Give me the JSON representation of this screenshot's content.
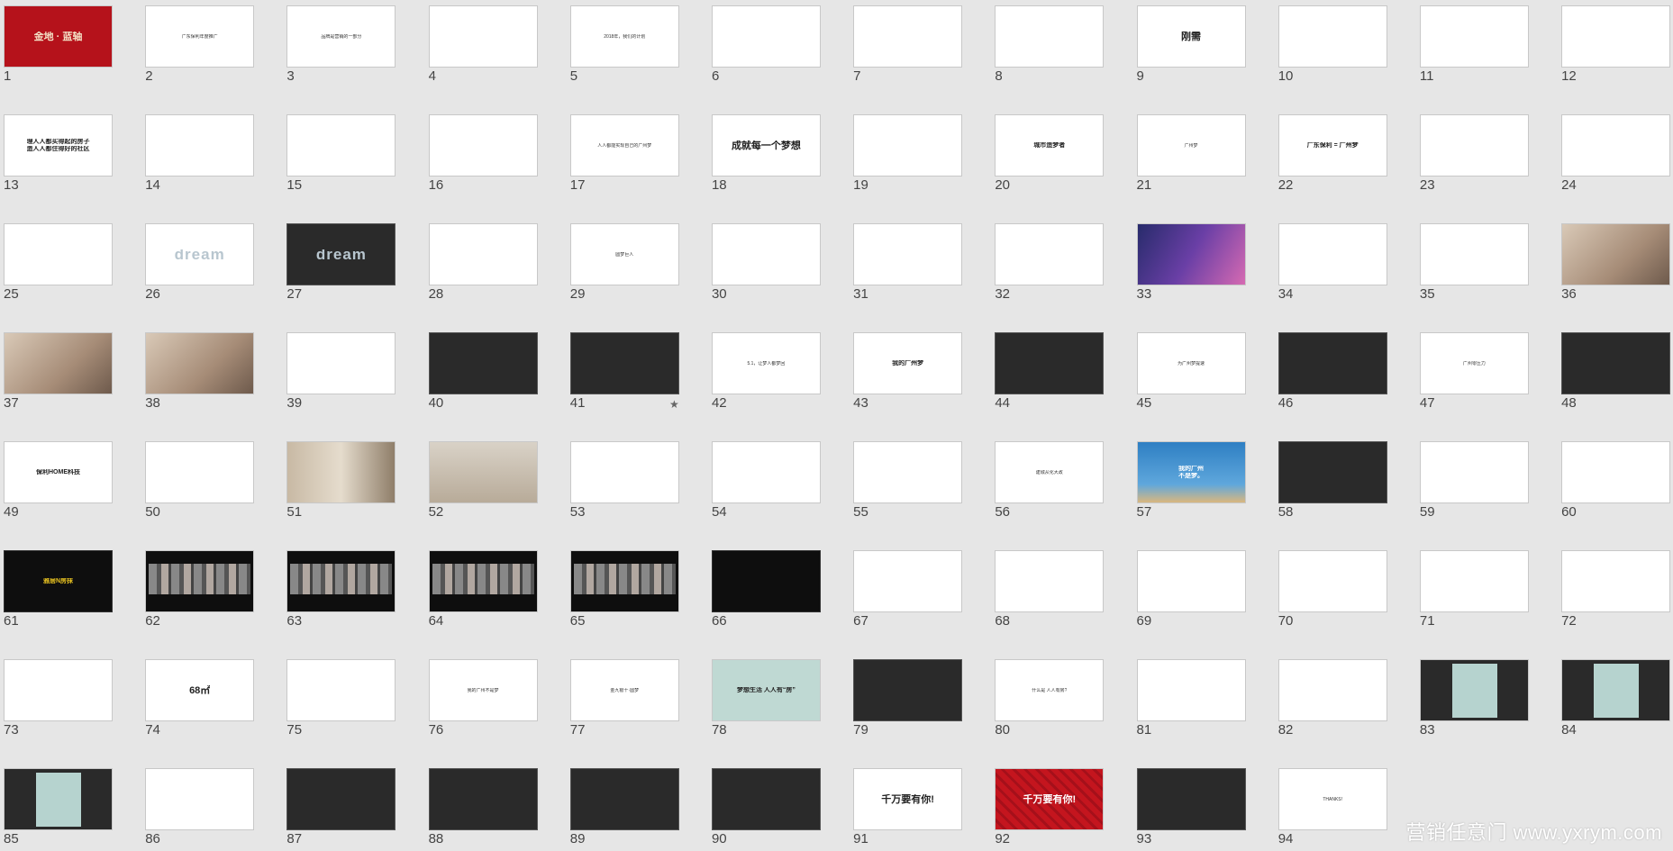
{
  "slides": [
    {
      "n": "1",
      "s": "red",
      "lines": [
        [
          "big",
          "金地 · 蓝轴"
        ],
        [
          "t",
          ""
        ]
      ]
    },
    {
      "n": "2",
      "s": "white",
      "lines": [
        [
          "t",
          "广东保利年度推广"
        ]
      ]
    },
    {
      "n": "3",
      "s": "white",
      "lines": [
        [
          "t",
          "品牌是营销的一部分"
        ]
      ]
    },
    {
      "n": "4",
      "s": "white",
      "lines": [
        [
          "t",
          ""
        ]
      ]
    },
    {
      "n": "5",
      "s": "white",
      "lines": [
        [
          "t",
          "2018年，我们的计划"
        ]
      ]
    },
    {
      "n": "6",
      "s": "white",
      "lines": [
        [
          "t",
          ""
        ]
      ]
    },
    {
      "n": "7",
      "s": "white",
      "lines": [
        [
          "t",
          ""
        ]
      ]
    },
    {
      "n": "8",
      "s": "white",
      "lines": [
        [
          "t",
          ""
        ]
      ]
    },
    {
      "n": "9",
      "s": "white",
      "lines": [
        [
          "big",
          "刚需"
        ]
      ]
    },
    {
      "n": "10",
      "s": "white",
      "lines": [
        [
          "t",
          ""
        ]
      ]
    },
    {
      "n": "11",
      "s": "white",
      "lines": [
        [
          "t",
          ""
        ]
      ]
    },
    {
      "n": "12",
      "s": "white",
      "lines": [
        [
          "t",
          ""
        ]
      ]
    },
    {
      "n": "13",
      "s": "white",
      "lines": [
        [
          "mid",
          "理人人都买得起的房子"
        ],
        [
          "mid",
          "造人人都住得好的社区"
        ]
      ]
    },
    {
      "n": "14",
      "s": "white",
      "lines": [
        [
          "t",
          ""
        ]
      ]
    },
    {
      "n": "15",
      "s": "white",
      "lines": [
        [
          "t",
          ""
        ]
      ]
    },
    {
      "n": "16",
      "s": "white",
      "lines": [
        [
          "t",
          ""
        ]
      ]
    },
    {
      "n": "17",
      "s": "white",
      "lines": [
        [
          "t",
          "人人都能实现自己的广州梦"
        ]
      ]
    },
    {
      "n": "18",
      "s": "white",
      "lines": [
        [
          "big",
          "成就每一个梦想"
        ]
      ]
    },
    {
      "n": "19",
      "s": "white",
      "lines": [
        [
          "t",
          ""
        ]
      ]
    },
    {
      "n": "20",
      "s": "white",
      "lines": [
        [
          "mid",
          "城市造梦者"
        ]
      ]
    },
    {
      "n": "21",
      "s": "white",
      "lines": [
        [
          "t",
          "广州梦"
        ]
      ]
    },
    {
      "n": "22",
      "s": "white",
      "lines": [
        [
          "mid",
          "广东保利 = 广州梦"
        ]
      ]
    },
    {
      "n": "23",
      "s": "white",
      "lines": [
        [
          "t",
          ""
        ]
      ]
    },
    {
      "n": "24",
      "s": "white",
      "lines": [
        [
          "t",
          ""
        ]
      ]
    },
    {
      "n": "25",
      "s": "white",
      "lines": [
        [
          "t",
          ""
        ]
      ]
    },
    {
      "n": "26",
      "s": "dream",
      "lines": [
        [
          "big",
          "dream"
        ]
      ]
    },
    {
      "n": "27",
      "s": "dreamdark",
      "lines": [
        [
          "big",
          "dream"
        ]
      ]
    },
    {
      "n": "28",
      "s": "white",
      "lines": [
        [
          "t",
          ""
        ]
      ]
    },
    {
      "n": "29",
      "s": "white",
      "lines": [
        [
          "t",
          "圆梦巨人"
        ]
      ]
    },
    {
      "n": "30",
      "s": "white",
      "lines": [
        [
          "t",
          ""
        ]
      ]
    },
    {
      "n": "31",
      "s": "white",
      "lines": [
        [
          "t",
          ""
        ]
      ]
    },
    {
      "n": "32",
      "s": "white",
      "lines": [
        [
          "t",
          ""
        ]
      ]
    },
    {
      "n": "33",
      "s": "scifi",
      "lines": [
        [
          "t",
          ""
        ]
      ]
    },
    {
      "n": "34",
      "s": "white",
      "lines": [
        [
          "t",
          ""
        ]
      ]
    },
    {
      "n": "35",
      "s": "white",
      "lines": [
        [
          "t",
          ""
        ]
      ]
    },
    {
      "n": "36",
      "s": "photo",
      "lines": [
        [
          "t",
          ""
        ]
      ]
    },
    {
      "n": "37",
      "s": "photo",
      "lines": [
        [
          "t",
          ""
        ]
      ]
    },
    {
      "n": "38",
      "s": "photo",
      "lines": [
        [
          "t",
          ""
        ]
      ]
    },
    {
      "n": "39",
      "s": "white",
      "lines": [
        [
          "t",
          ""
        ]
      ]
    },
    {
      "n": "40",
      "s": "dark",
      "lines": [
        [
          "t",
          ""
        ]
      ]
    },
    {
      "n": "41",
      "s": "dark",
      "lines": [
        [
          "t",
          ""
        ]
      ],
      "star": "★"
    },
    {
      "n": "42",
      "s": "white",
      "lines": [
        [
          "t",
          "5.1，让梦人都梦回"
        ]
      ]
    },
    {
      "n": "43",
      "s": "white",
      "lines": [
        [
          "mid",
          "我的广州梦"
        ]
      ]
    },
    {
      "n": "44",
      "s": "dark",
      "lines": [
        [
          "t",
          ""
        ]
      ]
    },
    {
      "n": "45",
      "s": "white",
      "lines": [
        [
          "t",
          "为广州梦提速"
        ]
      ]
    },
    {
      "n": "46",
      "s": "dark",
      "lines": [
        [
          "t",
          ""
        ]
      ]
    },
    {
      "n": "47",
      "s": "white",
      "lines": [
        [
          "t",
          "广州零压力"
        ]
      ]
    },
    {
      "n": "48",
      "s": "dark",
      "lines": [
        [
          "t",
          ""
        ]
      ]
    },
    {
      "n": "49",
      "s": "white",
      "lines": [
        [
          "mid",
          "保利HOME科技"
        ]
      ]
    },
    {
      "n": "50",
      "s": "white",
      "lines": [
        [
          "t",
          ""
        ]
      ]
    },
    {
      "n": "51",
      "s": "wall",
      "lines": [
        [
          "t",
          ""
        ]
      ]
    },
    {
      "n": "52",
      "s": "room",
      "lines": [
        [
          "t",
          ""
        ]
      ]
    },
    {
      "n": "53",
      "s": "white",
      "lines": [
        [
          "t",
          ""
        ]
      ]
    },
    {
      "n": "54",
      "s": "white",
      "lines": [
        [
          "t",
          ""
        ]
      ]
    },
    {
      "n": "55",
      "s": "white",
      "lines": [
        [
          "t",
          ""
        ]
      ]
    },
    {
      "n": "56",
      "s": "white",
      "lines": [
        [
          "t",
          "建城从化大政"
        ]
      ]
    },
    {
      "n": "57",
      "s": "blue",
      "lines": [
        [
          "mid",
          "我的广州"
        ],
        [
          "mid",
          "不是梦。"
        ]
      ]
    },
    {
      "n": "58",
      "s": "dark",
      "lines": [
        [
          "t",
          ""
        ]
      ]
    },
    {
      "n": "59",
      "s": "white",
      "lines": [
        [
          "t",
          ""
        ]
      ]
    },
    {
      "n": "60",
      "s": "white",
      "lines": [
        [
          "t",
          ""
        ]
      ]
    },
    {
      "n": "61",
      "s": "black",
      "lines": [
        [
          "mid",
          "雅居N房抹"
        ]
      ]
    },
    {
      "n": "62",
      "s": "street",
      "lines": [
        [
          "t",
          ""
        ]
      ]
    },
    {
      "n": "63",
      "s": "street",
      "lines": [
        [
          "t",
          ""
        ]
      ]
    },
    {
      "n": "64",
      "s": "street",
      "lines": [
        [
          "t",
          ""
        ]
      ]
    },
    {
      "n": "65",
      "s": "street",
      "lines": [
        [
          "t",
          ""
        ]
      ]
    },
    {
      "n": "66",
      "s": "black",
      "lines": [
        [
          "t",
          ""
        ]
      ]
    },
    {
      "n": "67",
      "s": "white",
      "lines": [
        [
          "t",
          ""
        ]
      ]
    },
    {
      "n": "68",
      "s": "white",
      "lines": [
        [
          "t",
          ""
        ]
      ]
    },
    {
      "n": "69",
      "s": "white",
      "lines": [
        [
          "t",
          ""
        ]
      ]
    },
    {
      "n": "70",
      "s": "white",
      "lines": [
        [
          "t",
          ""
        ]
      ]
    },
    {
      "n": "71",
      "s": "white",
      "lines": [
        [
          "t",
          ""
        ]
      ]
    },
    {
      "n": "72",
      "s": "white",
      "lines": [
        [
          "t",
          ""
        ]
      ]
    },
    {
      "n": "73",
      "s": "white",
      "lines": [
        [
          "t",
          ""
        ]
      ]
    },
    {
      "n": "74",
      "s": "white",
      "lines": [
        [
          "big",
          "68㎡"
        ]
      ]
    },
    {
      "n": "75",
      "s": "white",
      "lines": [
        [
          "t",
          ""
        ]
      ]
    },
    {
      "n": "76",
      "s": "white",
      "lines": [
        [
          "t",
          "我的广州不是梦"
        ]
      ]
    },
    {
      "n": "77",
      "s": "white",
      "lines": [
        [
          "t",
          "金九银十·圆梦"
        ]
      ]
    },
    {
      "n": "78",
      "s": "mint",
      "lines": [
        [
          "mid",
          "梦想生活 人人有“房”"
        ]
      ]
    },
    {
      "n": "79",
      "s": "dark",
      "lines": [
        [
          "t",
          ""
        ]
      ]
    },
    {
      "n": "80",
      "s": "white",
      "lines": [
        [
          "t",
          "什么是 人人有房?"
        ]
      ]
    },
    {
      "n": "81",
      "s": "white",
      "lines": [
        [
          "t",
          ""
        ]
      ]
    },
    {
      "n": "82",
      "s": "white",
      "lines": [
        [
          "t",
          ""
        ]
      ]
    },
    {
      "n": "83",
      "s": "teal",
      "lines": [
        [
          "t",
          ""
        ]
      ]
    },
    {
      "n": "84",
      "s": "teal",
      "lines": [
        [
          "t",
          ""
        ]
      ]
    },
    {
      "n": "85",
      "s": "teal",
      "lines": [
        [
          "t",
          ""
        ]
      ]
    },
    {
      "n": "86",
      "s": "white",
      "lines": [
        [
          "t",
          ""
        ]
      ]
    },
    {
      "n": "87",
      "s": "dark",
      "lines": [
        [
          "t",
          ""
        ]
      ]
    },
    {
      "n": "88",
      "s": "dark",
      "lines": [
        [
          "t",
          ""
        ]
      ]
    },
    {
      "n": "89",
      "s": "dark",
      "lines": [
        [
          "t",
          ""
        ]
      ]
    },
    {
      "n": "90",
      "s": "dark",
      "lines": [
        [
          "t",
          ""
        ]
      ]
    },
    {
      "n": "91",
      "s": "white",
      "lines": [
        [
          "big",
          "千万要有你!"
        ]
      ]
    },
    {
      "n": "92",
      "s": "redpattern",
      "lines": [
        [
          "big",
          "千万要有你!"
        ]
      ]
    },
    {
      "n": "93",
      "s": "dark",
      "lines": [
        [
          "t",
          ""
        ]
      ]
    },
    {
      "n": "94",
      "s": "white",
      "lines": [
        [
          "t",
          "THANKS!"
        ]
      ]
    }
  ],
  "watermark": "营销任意门 www.yxrym.com"
}
